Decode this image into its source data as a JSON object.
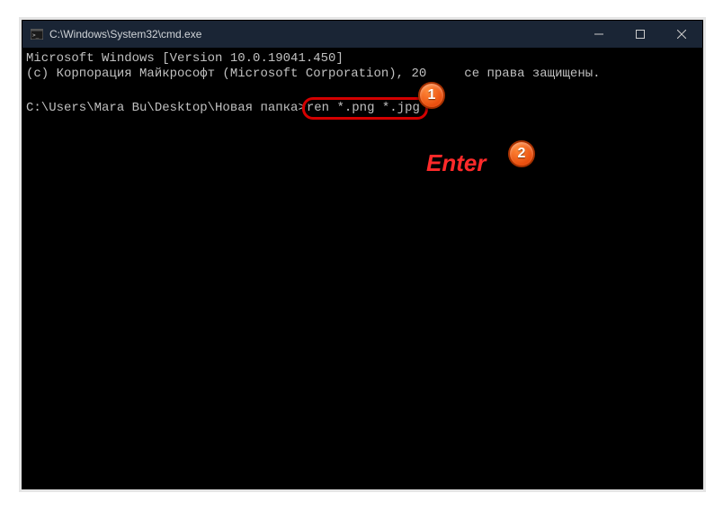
{
  "titlebar": {
    "title": "C:\\Windows\\System32\\cmd.exe"
  },
  "terminal": {
    "line1": "Microsoft Windows [Version 10.0.19041.450]",
    "line2_a": "(c) Корпорация Майкрософт (Microsoft Corporation), 20",
    "line2_b": "се права защищены.",
    "prompt": "C:\\Users\\Mara Bu\\Desktop\\Новая папка>",
    "command": "ren *.png *.jpg"
  },
  "annotations": {
    "badge1": "1",
    "badge2": "2",
    "enter": "Enter"
  }
}
